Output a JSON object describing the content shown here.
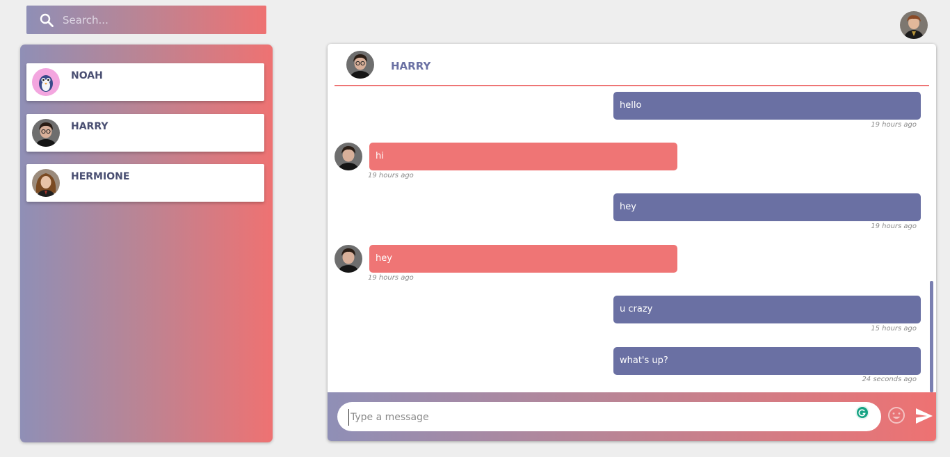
{
  "search": {
    "placeholder": "Search..."
  },
  "contacts": [
    {
      "name": "NOAH",
      "avatar": "penguin-avatar"
    },
    {
      "name": "HARRY",
      "avatar": "harry-avatar"
    },
    {
      "name": "HERMIONE",
      "avatar": "hermione-avatar"
    }
  ],
  "chat": {
    "title": "HARRY",
    "messages": [
      {
        "text": "hello",
        "time": "19 hours ago",
        "direction": "out"
      },
      {
        "text": "hi",
        "time": "19 hours ago",
        "direction": "in"
      },
      {
        "text": "hey",
        "time": "19 hours ago",
        "direction": "out"
      },
      {
        "text": "hey",
        "time": "19 hours ago",
        "direction": "in"
      },
      {
        "text": "u crazy",
        "time": "15 hours ago",
        "direction": "out"
      },
      {
        "text": "what's up?",
        "time": "24 seconds ago",
        "direction": "out"
      }
    ],
    "composer": {
      "placeholder": "Type a message"
    }
  },
  "icons": {
    "search": "search-icon",
    "emoji": "emoji-icon",
    "send": "send-icon",
    "grammarly": "grammarly-icon"
  },
  "colors": {
    "gradient_start": "#8f8fb6",
    "gradient_end": "#ee7272",
    "outgoing_bubble": "#6a70a3",
    "incoming_bubble": "#ef7575",
    "contact_name": "#4a4f72"
  }
}
